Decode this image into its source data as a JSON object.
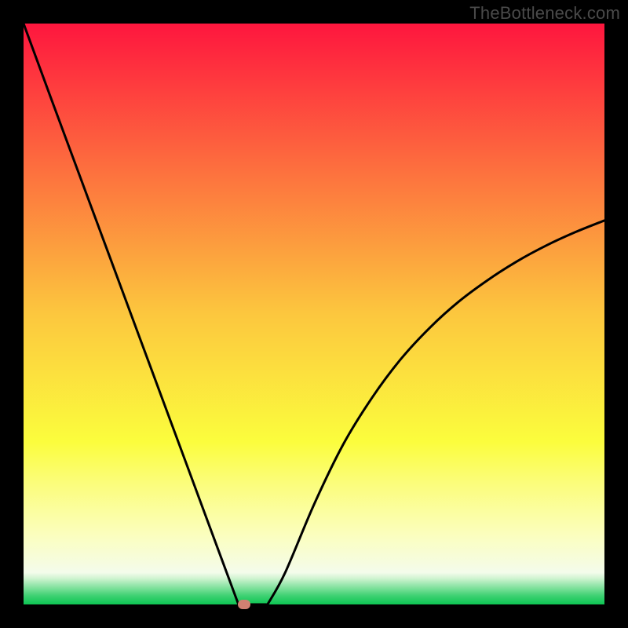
{
  "watermark": "TheBottleneck.com",
  "chart_data": {
    "type": "line",
    "title": "",
    "xlabel": "",
    "ylabel": "",
    "xlim": [
      0,
      100
    ],
    "ylim": [
      0,
      100
    ],
    "x": [
      0,
      5,
      10,
      15,
      20,
      25,
      30,
      34,
      36,
      37,
      38,
      42,
      45,
      50,
      55,
      60,
      65,
      70,
      75,
      80,
      85,
      90,
      95,
      100
    ],
    "values": [
      100,
      86.4,
      72.9,
      59.4,
      45.9,
      32.4,
      18.9,
      8.1,
      2.7,
      0.0,
      0.0,
      0.0,
      5.4,
      17.2,
      27.5,
      35.6,
      42.3,
      47.7,
      52.2,
      55.9,
      59.1,
      61.8,
      64.1,
      66.1
    ],
    "marker": {
      "x": 38,
      "y": 0,
      "color": "#d08072"
    },
    "background": {
      "type": "gradient",
      "stops": [
        {
          "pos": 0.0,
          "color": "#fe163e"
        },
        {
          "pos": 0.25,
          "color": "#fd6f3e"
        },
        {
          "pos": 0.5,
          "color": "#fcc73e"
        },
        {
          "pos": 0.72,
          "color": "#fbfd3d"
        },
        {
          "pos": 0.79,
          "color": "#fbfd7a"
        },
        {
          "pos": 0.88,
          "color": "#fbfebe"
        },
        {
          "pos": 0.945,
          "color": "#f4fceb"
        },
        {
          "pos": 0.955,
          "color": "#d0f4d1"
        },
        {
          "pos": 0.965,
          "color": "#9fe8b1"
        },
        {
          "pos": 0.975,
          "color": "#6fdd92"
        },
        {
          "pos": 0.985,
          "color": "#3ed172"
        },
        {
          "pos": 1.0,
          "color": "#0dc653"
        }
      ]
    }
  }
}
